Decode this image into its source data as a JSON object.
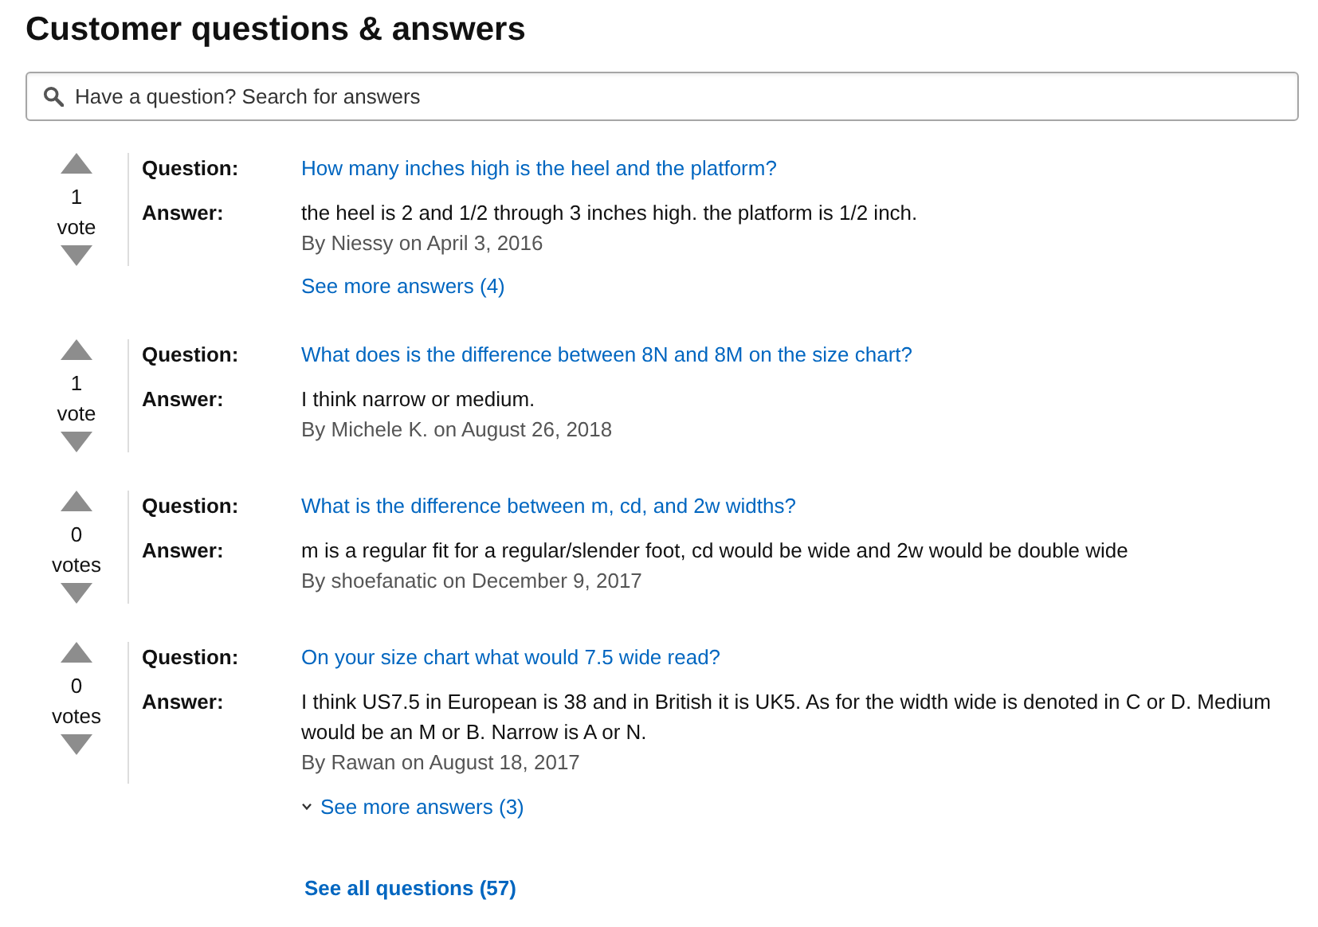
{
  "title": "Customer questions & answers",
  "search": {
    "placeholder": "Have a question? Search for answers"
  },
  "questions": [
    {
      "votes": "1",
      "vote_label": "vote",
      "question_label": "Question:",
      "question": "How many inches high is the heel and the platform?",
      "answer_label": "Answer:",
      "answer": "the heel is 2 and 1/2 through 3 inches high. the platform is 1/2 inch.",
      "byline": "By Niessy on April 3, 2016",
      "more": {
        "label": "See more answers (4)",
        "caret": false
      }
    },
    {
      "votes": "1",
      "vote_label": "vote",
      "question_label": "Question:",
      "question": "What does is the difference between 8N and 8M on the size chart?",
      "answer_label": "Answer:",
      "answer": "I think narrow or medium.",
      "byline": "By Michele K. on August 26, 2018"
    },
    {
      "votes": "0",
      "vote_label": "votes",
      "question_label": "Question:",
      "question": "What is the difference between m, cd, and 2w widths?",
      "answer_label": "Answer:",
      "answer": "m is a regular fit for a regular/slender foot, cd would be wide and 2w would be double wide",
      "byline": "By shoefanatic on December 9, 2017"
    },
    {
      "votes": "0",
      "vote_label": "votes",
      "question_label": "Question:",
      "question": "On your size chart what would 7.5 wide read?",
      "answer_label": "Answer:",
      "answer": "I think US7.5 in European is 38 and in British it is UK5. As for the width wide is denoted in C or D. Medium would be an M or B. Narrow is A or N.",
      "byline": "By Rawan on August 18, 2017",
      "more": {
        "label": "See more answers (3)",
        "caret": true
      }
    }
  ],
  "see_all": "See all questions (57)"
}
